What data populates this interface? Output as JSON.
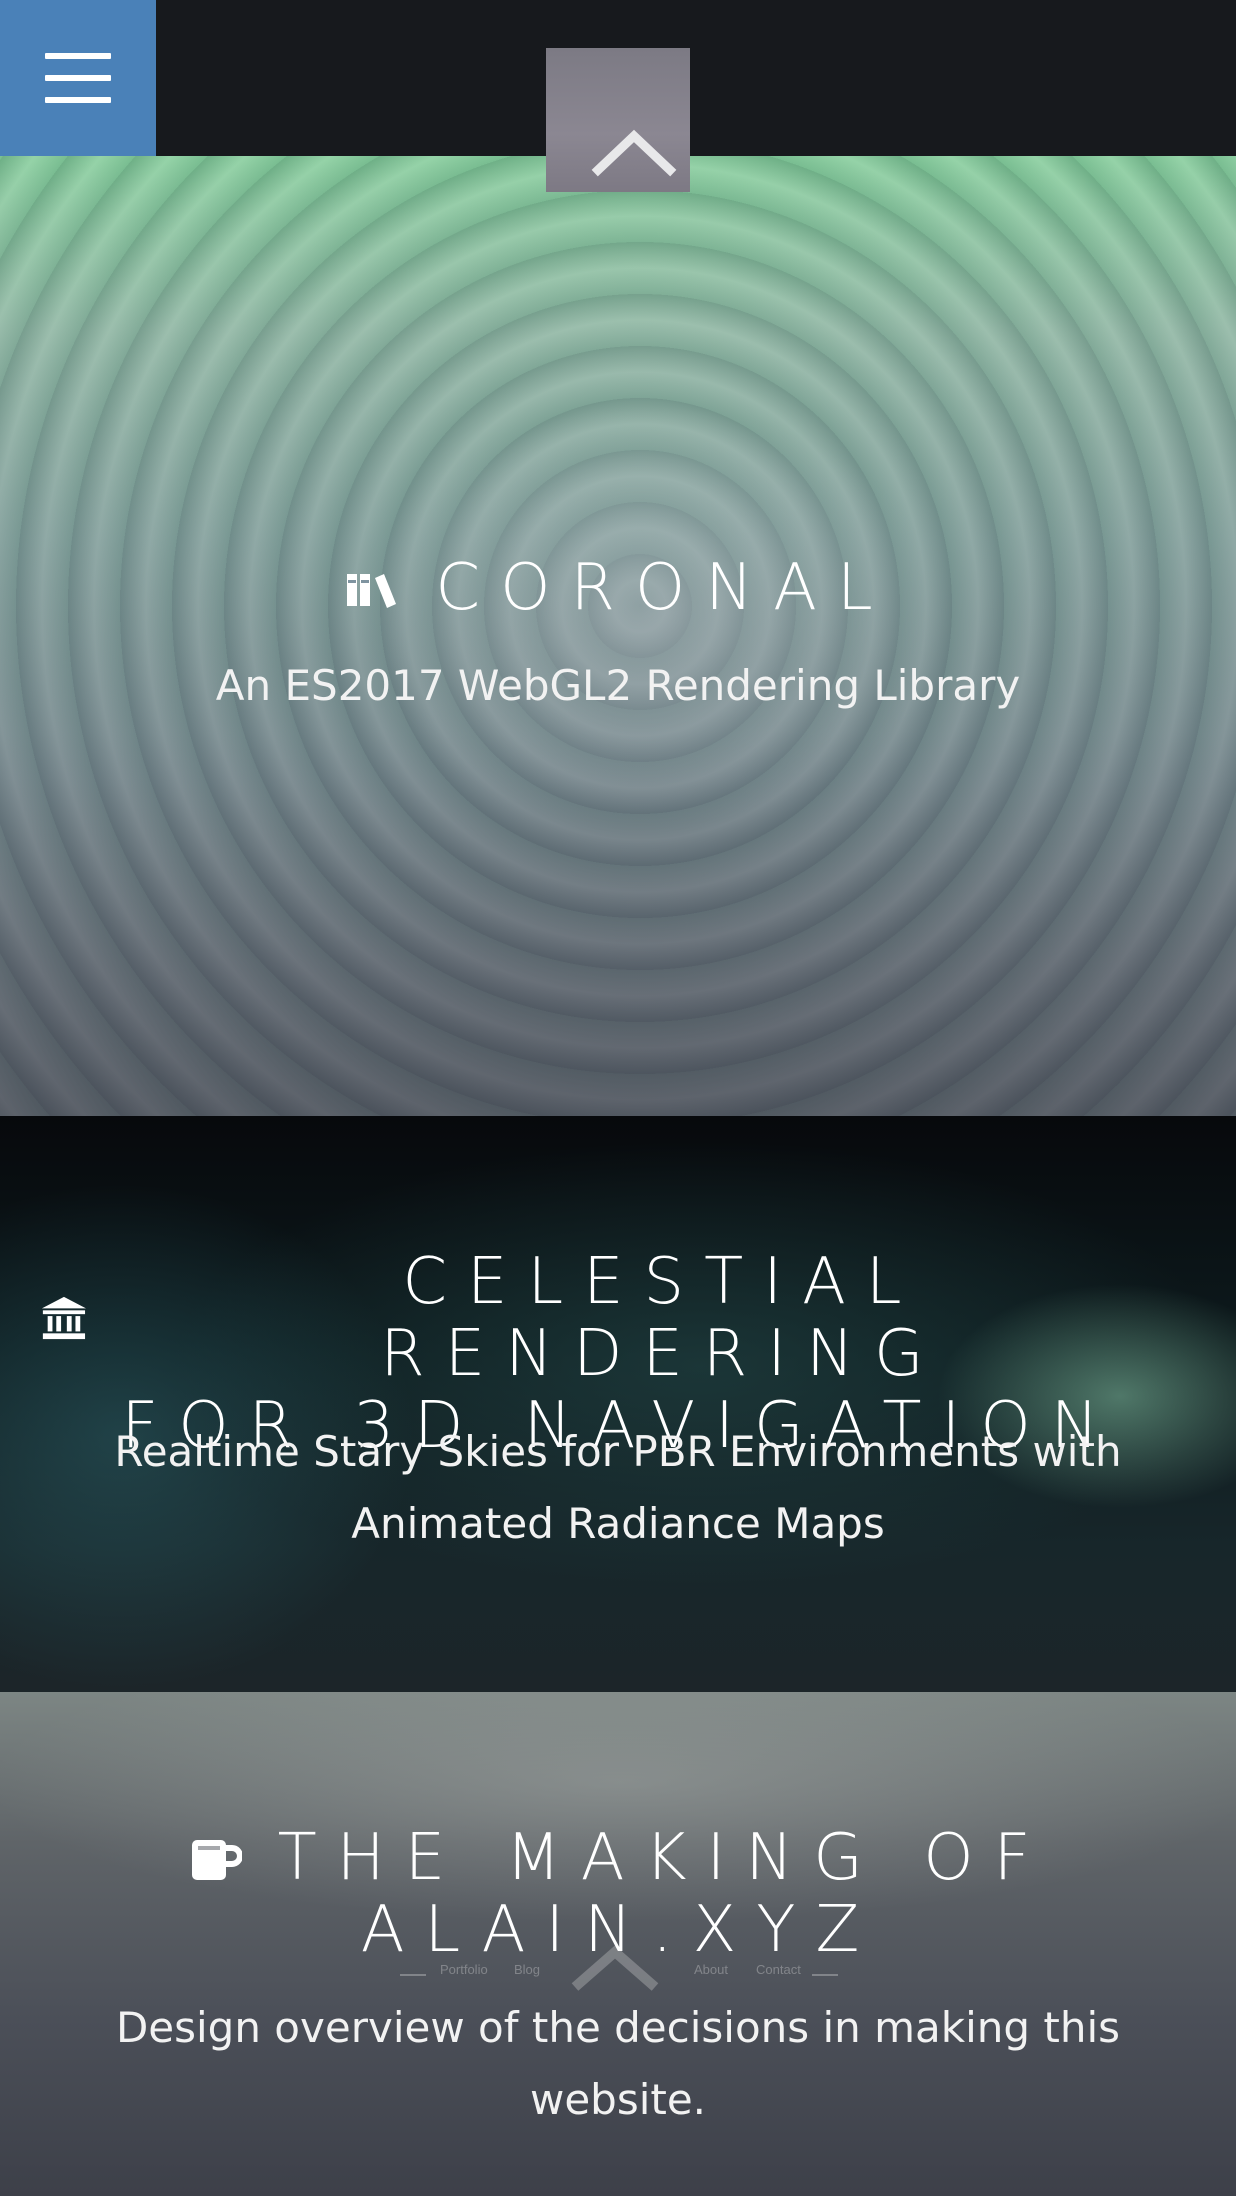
{
  "header": {
    "menu_icon": "hamburger-icon",
    "logo_icon": "chevron-up-icon",
    "accent_color": "#4a81b8"
  },
  "sections": [
    {
      "icon": "books-icon",
      "title": "CORONAL",
      "subtitle": "An ES2017 WebGL2 Rendering Library"
    },
    {
      "icon": "institution-icon",
      "title_line1": "CELESTIAL RENDERING",
      "title_line2": "FOR 3D NAVIGATION",
      "subtitle_line1": "Realtime Stary Skies for PBR Environments with",
      "subtitle_line2": "Animated Radiance Maps"
    },
    {
      "icon": "mug-icon",
      "title_line1": "THE MAKING OF",
      "title_line2": "ALAIN.XYZ",
      "subtitle_line1": "Design overview of the decisions in making this",
      "subtitle_line2": "website.",
      "ghost_nav": [
        "Portfolio",
        "Blog",
        "About",
        "Contact"
      ]
    }
  ]
}
